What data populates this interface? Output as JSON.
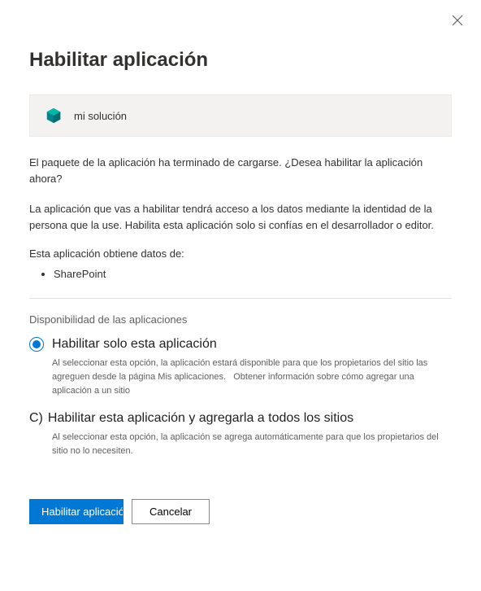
{
  "dialog": {
    "title": "Habilitar aplicación",
    "app": {
      "icon_name": "package-icon",
      "name": "mi solución"
    },
    "intro": "El paquete de la aplicación ha terminado de cargarse. ¿Desea habilitar la aplicación ahora?",
    "warning": "La aplicación que vas a habilitar tendrá acceso a los datos mediante la identidad de la persona que la use. Habilita esta aplicación solo si confías en el desarrollador o editor.",
    "data_sources_label": "Esta aplicación obtiene datos de:",
    "data_sources": [
      "SharePoint"
    ],
    "availability_label": "Disponibilidad de las aplicaciones",
    "options": [
      {
        "selected": true,
        "label": "Habilitar solo esta aplicación",
        "desc": "Al seleccionar esta opción, la aplicación estará disponible para que los propietarios del sitio las agreguen desde la página Mis aplicaciones.",
        "link_text": "Obtener información sobre cómo agregar una aplicación a un sitio"
      },
      {
        "selected": false,
        "marker": "C)",
        "label": "Habilitar esta aplicación y agregarla a todos los sitios",
        "desc": "Al seleccionar esta opción, la aplicación se agrega automáticamente para que los propietarios del sitio no lo necesiten."
      }
    ],
    "buttons": {
      "primary": "Habilitar aplicación",
      "secondary": "Cancelar"
    }
  }
}
